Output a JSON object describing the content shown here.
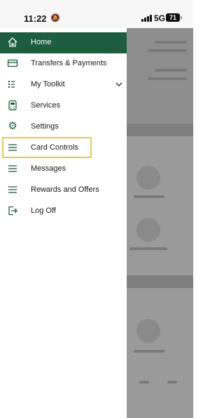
{
  "status_bar": {
    "time": "11:22",
    "network": "5G",
    "battery": "71",
    "mute_icon": "bell-slash-icon",
    "signal_icon": "signal-bars-icon"
  },
  "menu": {
    "items": [
      {
        "label": "Home",
        "icon": "home-icon",
        "active": true
      },
      {
        "label": "Transfers & Payments",
        "icon": "card-icon"
      },
      {
        "label": "My Toolkit",
        "icon": "toolkit-icon",
        "has_chevron": true
      },
      {
        "label": "Services",
        "icon": "calculator-icon"
      },
      {
        "label": "Settings",
        "icon": "gear-icon"
      },
      {
        "label": "Card Controls",
        "icon": "menu-lines-icon",
        "highlighted": true
      },
      {
        "label": "Messages",
        "icon": "menu-lines-icon"
      },
      {
        "label": "Rewards and Offers",
        "icon": "menu-lines-icon"
      },
      {
        "label": "Log Off",
        "icon": "logout-icon"
      }
    ]
  },
  "colors": {
    "active_bg": "#1d5d3d",
    "icon": "#1d5d3d",
    "highlight_border": "#e6c84f",
    "overlay": "#9a9a9a"
  }
}
